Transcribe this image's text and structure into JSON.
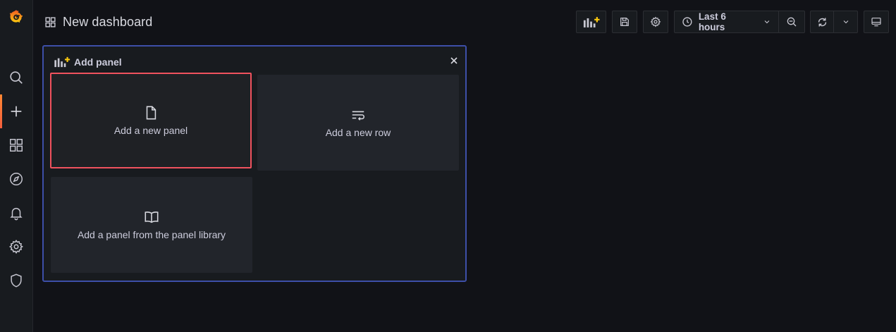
{
  "app": {
    "logo": "grafana-logo"
  },
  "sidebar": {
    "items": [
      {
        "icon": "search-icon",
        "label": "Search"
      },
      {
        "icon": "plus-icon",
        "label": "Create"
      },
      {
        "icon": "dashboards-icon",
        "label": "Dashboards"
      },
      {
        "icon": "compass-icon",
        "label": "Explore"
      },
      {
        "icon": "bell-icon",
        "label": "Alerting"
      },
      {
        "icon": "gear-icon",
        "label": "Configuration"
      },
      {
        "icon": "shield-icon",
        "label": "Server Admin"
      }
    ],
    "active_index": 1
  },
  "header": {
    "title": "New dashboard",
    "time_range": "Last 6 hours"
  },
  "add_panel": {
    "title": "Add panel",
    "options": [
      {
        "label": "Add a new panel",
        "icon": "file-icon"
      },
      {
        "label": "Add a new row",
        "icon": "wrap-text-icon"
      },
      {
        "label": "Add a panel from the panel library",
        "icon": "book-open-icon"
      }
    ]
  },
  "colors": {
    "background": "#111217",
    "panel_border": "#3d4fa8",
    "selected_border": "#f0525e",
    "brand_orange": "#f46800",
    "accent_yellow": "#fbc90f"
  }
}
